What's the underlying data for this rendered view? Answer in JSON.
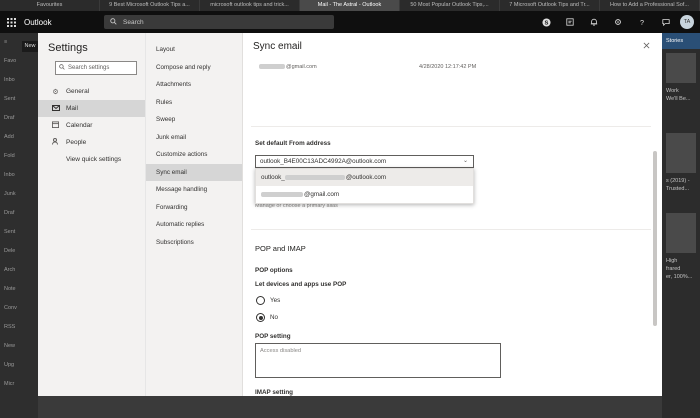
{
  "browser": {
    "tabs": [
      {
        "label": "Favourites",
        "active": false
      },
      {
        "label": "9 Best Microsoft Outlook Tips a...",
        "active": false
      },
      {
        "label": "microsoft outlook tips and trick...",
        "active": false
      },
      {
        "label": "Mail - The Astral - Outlook",
        "active": true
      },
      {
        "label": "50 Most Popular Outlook Tips,...",
        "active": false
      },
      {
        "label": "7 Microsoft Outlook Tips and Tr...",
        "active": false
      },
      {
        "label": "How to Add a Professional Sof...",
        "active": false
      }
    ]
  },
  "header": {
    "app_name": "Outlook",
    "search_placeholder": "Search",
    "avatar_initials": "TA"
  },
  "background": {
    "new_button": "New",
    "nav_items": [
      "Favo",
      "Inbo",
      "Sent",
      "Draf",
      "Add",
      "",
      "Fold",
      "Inbo",
      "Junk",
      "Draf",
      "Sent",
      "Dele",
      "Arch",
      "Note",
      "Conv",
      "",
      "RSS",
      "New",
      "Upg",
      "Micr"
    ],
    "right_header": "Stories",
    "right_snippets": [
      "Work",
      "We'll Be...",
      "s (2019) -",
      "Trusted...",
      "High",
      "frared",
      "er, 100%..."
    ]
  },
  "settings": {
    "title": "Settings",
    "search_placeholder": "Search settings",
    "categories": [
      {
        "label": "General",
        "icon": "gear-icon",
        "selected": false
      },
      {
        "label": "Mail",
        "icon": "mail-icon",
        "selected": true
      },
      {
        "label": "Calendar",
        "icon": "calendar-icon",
        "selected": false
      },
      {
        "label": "People",
        "icon": "people-icon",
        "selected": false
      },
      {
        "label": "View quick settings",
        "icon": "",
        "selected": false
      }
    ],
    "subcategories": [
      {
        "label": "Layout",
        "selected": false
      },
      {
        "label": "Compose and reply",
        "selected": false
      },
      {
        "label": "Attachments",
        "selected": false
      },
      {
        "label": "Rules",
        "selected": false
      },
      {
        "label": "Sweep",
        "selected": false
      },
      {
        "label": "Junk email",
        "selected": false
      },
      {
        "label": "Customize actions",
        "selected": false
      },
      {
        "label": "Sync email",
        "selected": true
      },
      {
        "label": "Message handling",
        "selected": false
      },
      {
        "label": "Forwarding",
        "selected": false
      },
      {
        "label": "Automatic replies",
        "selected": false
      },
      {
        "label": "Subscriptions",
        "selected": false
      }
    ]
  },
  "content": {
    "title": "Sync email",
    "account": {
      "email_suffix": "@gmail.com",
      "date": "4/28/2020 12:17:42 PM"
    },
    "default_from_label": "Set default From address",
    "dropdown_value": "outlook_B4E00C13ADC4992A@outlook.com",
    "dropdown_options": [
      {
        "prefix": "outlook_",
        "suffix": "@outlook.com",
        "highlighted": true
      },
      {
        "prefix": "",
        "suffix": "@gmail.com",
        "highlighted": false
      }
    ],
    "manage_text": "Manage or choose a primary alias",
    "pop_section_title": "POP and IMAP",
    "pop_options_label": "POP options",
    "pop_question": "Let devices and apps use POP",
    "radio_yes": "Yes",
    "radio_no": "No",
    "radio_selected": "No",
    "pop_setting_label": "POP setting",
    "pop_setting_value": "Access disabled",
    "imap_setting_label": "IMAP setting"
  }
}
